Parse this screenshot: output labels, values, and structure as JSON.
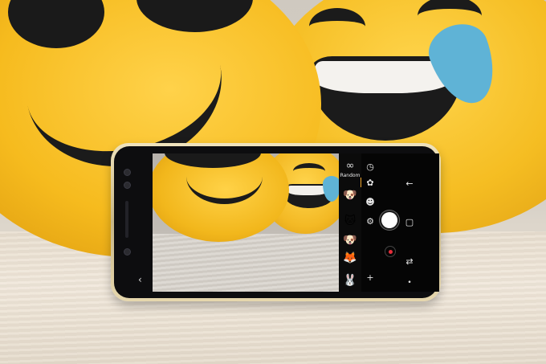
{
  "camera_ui": {
    "random_label": "Random",
    "icons": {
      "random": "infinity-icon",
      "timer": "timer-icon",
      "filters": "filters-icon",
      "settings": "gear-icon",
      "back": "back-arrow-icon",
      "switch_camera": "switch-camera-icon",
      "gallery": "gallery-icon",
      "add_sticker": "add-sticker-icon",
      "nav_back": "chevron-left-icon"
    },
    "stickers": [
      "🐶",
      "🐱",
      "🐶",
      "🦊",
      "🐰"
    ],
    "symbols": {
      "random": "∞",
      "timer": "◷",
      "filters": "✿",
      "settings": "⚙",
      "back": "←",
      "switch": "⇄",
      "gallery": "▢",
      "add": "+",
      "chevron": "‹",
      "dot": "•"
    },
    "colors": {
      "record": "#e62d3a",
      "selection": "#f2a72c"
    }
  }
}
